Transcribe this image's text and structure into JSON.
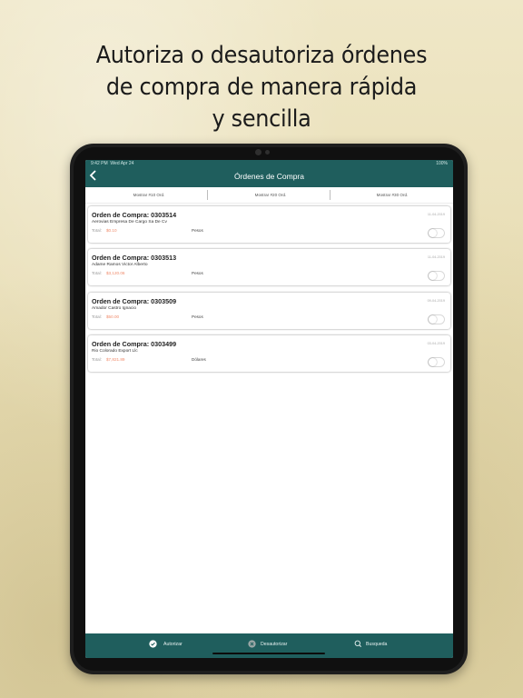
{
  "headline": {
    "line1": "Autoriza o desautoriza órdenes",
    "line2": "de compra de manera rápida",
    "line3": "y sencilla"
  },
  "status_bar": {
    "time": "9:42 PM",
    "date": "Wed Apr 24",
    "battery": "100%"
  },
  "nav": {
    "back_icon": "chevron-left-icon",
    "title": "Órdenes de Compra"
  },
  "filters": [
    {
      "label": "Mostrar #10 Ord."
    },
    {
      "label": "Mostrar #20 Ord."
    },
    {
      "label": "Mostrar #30 Ord."
    }
  ],
  "orders": [
    {
      "title": "Orden de Compra: 0303514",
      "date": "11-04-2019",
      "vendor": "Aerovias Empresa De Cargo Sa De Cv",
      "total_label": "Total:",
      "total": "$0.10",
      "currency": "Pesos",
      "authorized": false
    },
    {
      "title": "Orden de Compra: 0303513",
      "date": "11-04-2019",
      "vendor": "Adame Ramos Victor Alberto",
      "total_label": "Total:",
      "total": "$3,120.06",
      "currency": "Pesos",
      "authorized": false
    },
    {
      "title": "Orden de Compra: 0303509",
      "date": "09-04-2019",
      "vendor": " Amador Castro Ignacio",
      "total_label": "Total:",
      "total": "$50.00",
      "currency": "Pesos",
      "authorized": false
    },
    {
      "title": "Orden de Compra: 0303499",
      "date": "03-04-2019",
      "vendor": "Rio Colorado Export Llc",
      "total_label": "Total:",
      "total": "$7,821.89",
      "currency": "Dólares",
      "authorized": false
    }
  ],
  "tabbar": [
    {
      "label": "Autorizar",
      "icon": "check-circle-icon"
    },
    {
      "label": "Desautorizar",
      "icon": "x-circle-icon"
    },
    {
      "label": "Busqueda",
      "icon": "search-icon"
    }
  ],
  "colors": {
    "primary": "#1f5e5d",
    "total_value": "#f08a6a"
  }
}
